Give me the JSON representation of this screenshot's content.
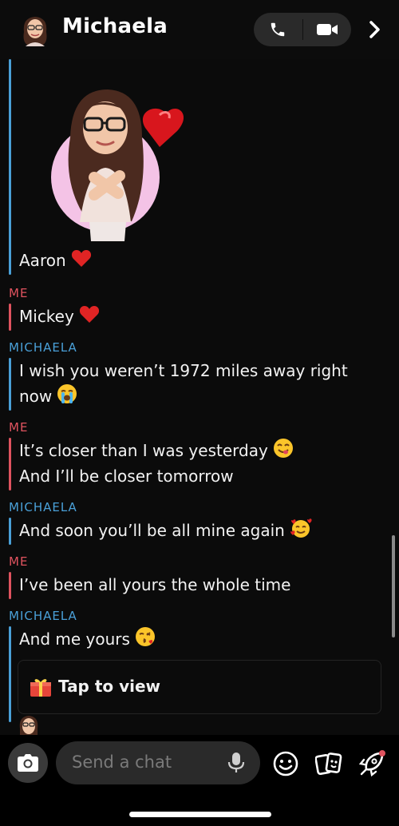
{
  "header": {
    "title": "Michaela"
  },
  "messages": [
    {
      "sender": "",
      "lines": [
        "Aaron"
      ],
      "emoji": "red-heart"
    },
    {
      "sender": "ME",
      "lines": [
        "Mickey"
      ],
      "emoji": "red-heart"
    },
    {
      "sender": "MICHAELA",
      "lines": [
        "I wish you weren’t 1972 miles away right",
        "now"
      ],
      "emoji": "loudly-crying-face"
    },
    {
      "sender": "ME",
      "lines": [
        "It’s closer than I was yesterday",
        "And I’ll be closer tomorrow"
      ],
      "emoji": "yum-face"
    },
    {
      "sender": "MICHAELA",
      "lines": [
        "And soon you’ll be all mine again"
      ],
      "emoji": "smiling-face-with-hearts"
    },
    {
      "sender": "ME",
      "lines": [
        "I’ve been all yours the whole time"
      ]
    },
    {
      "sender": "MICHAELA",
      "lines": [
        "And me yours"
      ],
      "emoji": "kissing-face"
    }
  ],
  "snap": {
    "label": "Tap to view",
    "icon": "gift-icon"
  },
  "composer": {
    "placeholder": "Send a chat"
  },
  "colors": {
    "me": "#e0535f",
    "friend": "#4aa0d8",
    "background": "#000000"
  }
}
